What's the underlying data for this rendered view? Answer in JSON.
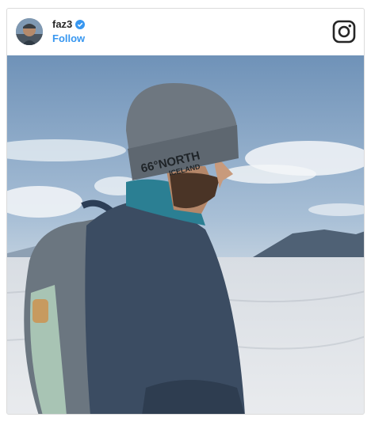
{
  "post": {
    "username": "faz3",
    "verified": true,
    "follow_label": "Follow",
    "platform_icon": "instagram-icon",
    "photo_hat_text_1": "66°NORTH",
    "photo_hat_text_2": "ICELAND"
  },
  "colors": {
    "accent": "#3897f0",
    "text": "#262626",
    "border": "#dbdbdb"
  }
}
